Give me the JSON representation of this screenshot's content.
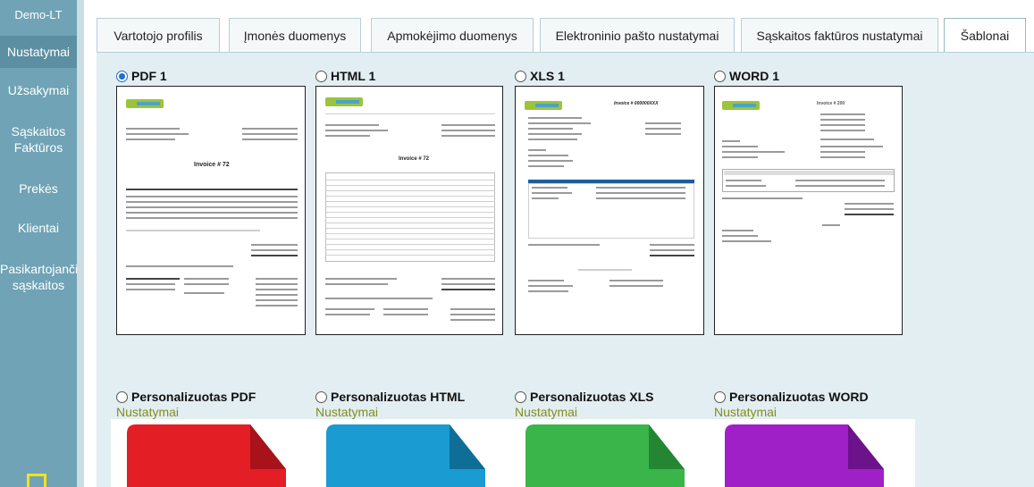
{
  "sidebar": {
    "brand": "Demo-LT",
    "items": [
      {
        "label": "Nustatymai"
      },
      {
        "label": "Užsakymai"
      },
      {
        "label": "Sąskaitos Faktūros"
      },
      {
        "label": "Prekės"
      },
      {
        "label": "Klientai"
      },
      {
        "label": "Pasikartojanči sąskaitos"
      }
    ]
  },
  "tabs": [
    {
      "label": "Vartotojo profilis"
    },
    {
      "label": "Įmonės duomenys"
    },
    {
      "label": "Apmokėjimo duomenys"
    },
    {
      "label": "Elektroninio pašto nustatymai"
    },
    {
      "label": "Sąskaitos faktūros nustatymai"
    },
    {
      "label": "Šablonai"
    }
  ],
  "templates": [
    {
      "label": "PDF 1",
      "selected": true
    },
    {
      "label": "HTML 1",
      "selected": false
    },
    {
      "label": "XLS 1",
      "selected": false
    },
    {
      "label": "WORD 1",
      "selected": false
    }
  ],
  "custom_templates": [
    {
      "label": "Personalizuotas PDF",
      "settings": "Nustatymai",
      "color": "#e31e24"
    },
    {
      "label": "Personalizuotas HTML",
      "settings": "Nustatymai",
      "color": "#1a9bd1"
    },
    {
      "label": "Personalizuotas XLS",
      "settings": "Nustatymai",
      "color": "#3ab54a"
    },
    {
      "label": "Personalizuotas WORD",
      "settings": "Nustatymai",
      "color": "#a020c8"
    }
  ],
  "thumb_text": {
    "invoice_title": "Invoice # 72",
    "html_title": "Invoice # 72",
    "xls_title": "Invoice # 000000XXX",
    "word_title": "Invoice # 200"
  },
  "colors": {
    "sidebar": "#6fa3b5",
    "sidebar_active": "#5b8fa1",
    "panel": "#e2eef2",
    "settings_link": "#7f8f1a",
    "radio_checked": "#1a6fd6"
  }
}
